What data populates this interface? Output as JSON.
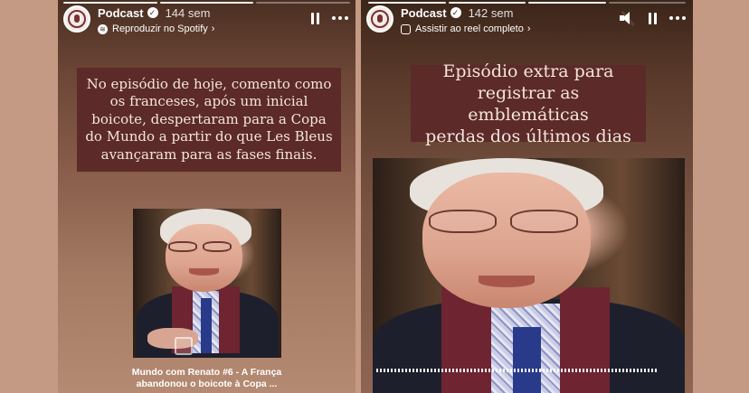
{
  "left_story": {
    "account": "Podcast",
    "time": "144 sem",
    "subtitle": "Reproduzir no Spotify",
    "text_lines": [
      "No episódio de hoje, comento como",
      "os franceses, após um inicial",
      "boicote, despertaram para a Copa",
      "do Mundo a partir do que Les Bleus",
      "avançaram para as fases finais."
    ],
    "caption_lines": [
      "Mundo com Renato #6 - A França",
      "abandonou o boicote à Copa ..."
    ],
    "progress": [
      1,
      1,
      0
    ]
  },
  "right_story": {
    "account": "Podcast",
    "time": "142 sem",
    "subtitle": "Assistir ao reel completo",
    "text_lines": [
      "Episódio extra para",
      "registrar as emblemáticas",
      "perdas dos últimos dias"
    ],
    "progress": [
      1,
      1,
      1,
      0
    ]
  },
  "colors": {
    "text_box_bg": "#5c2a29",
    "page_bg": "#c49a85"
  }
}
